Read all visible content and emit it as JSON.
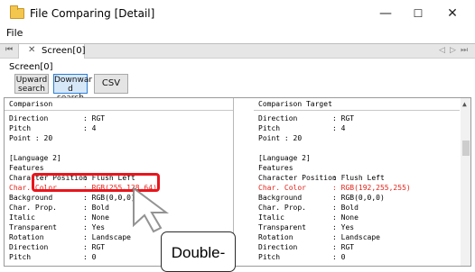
{
  "window": {
    "title": "File Comparing [Detail]",
    "controls": {
      "minimize": "—",
      "maximize": "☐",
      "close": "✕"
    }
  },
  "menu": {
    "file": "File"
  },
  "tabs": {
    "first_nav": "⏮",
    "items": [
      {
        "label": "Screen[0]",
        "close": "✕"
      }
    ],
    "nav_prev": "◁",
    "nav_next": "▷",
    "nav_last": "⏭"
  },
  "screen_label": "Screen[0]",
  "buttons": {
    "upward": [
      "Upward",
      "search"
    ],
    "downward": [
      "Downwar",
      "d search"
    ],
    "csv": "CSV"
  },
  "left_column": {
    "header": "Comparison",
    "rows": [
      {
        "k": "Direction",
        "v": ": RGT"
      },
      {
        "k": "Pitch",
        "v": ": 4"
      },
      {
        "k": "Point : 20",
        "v": ""
      },
      {
        "k": "",
        "v": ""
      },
      {
        "k": "[Language 2]",
        "v": ""
      },
      {
        "k": "Features",
        "v": ""
      },
      {
        "k": "Character Position",
        "v": ": Flush Left"
      },
      {
        "k": "Char. Color",
        "v": ": RGB(255,128,64)",
        "red": true
      },
      {
        "k": "Background",
        "v": ": RGB(0,0,0)"
      },
      {
        "k": "Char. Prop.",
        "v": ": Bold"
      },
      {
        "k": "Italic",
        "v": ": None"
      },
      {
        "k": "Transparent",
        "v": ": Yes"
      },
      {
        "k": "Rotation",
        "v": ": Landscape"
      },
      {
        "k": "Direction",
        "v": ": RGT"
      },
      {
        "k": "Pitch",
        "v": ": 0"
      }
    ]
  },
  "right_column": {
    "header": "Comparison Target",
    "rows": [
      {
        "k": "Direction",
        "v": ": RGT"
      },
      {
        "k": "Pitch",
        "v": ": 4"
      },
      {
        "k": "Point : 20",
        "v": ""
      },
      {
        "k": "",
        "v": ""
      },
      {
        "k": "[Language 2]",
        "v": ""
      },
      {
        "k": "Features",
        "v": ""
      },
      {
        "k": "Character Position",
        "v": ": Flush Left"
      },
      {
        "k": "Char. Color",
        "v": ": RGB(192,255,255)",
        "red": true
      },
      {
        "k": "Background",
        "v": ": RGB(0,0,0)"
      },
      {
        "k": "Char. Prop.",
        "v": ": Bold"
      },
      {
        "k": "Italic",
        "v": ": None"
      },
      {
        "k": "Transparent",
        "v": ": Yes"
      },
      {
        "k": "Rotation",
        "v": ": Landscape"
      },
      {
        "k": "Direction",
        "v": ": RGT"
      },
      {
        "k": "Pitch",
        "v": ": 0"
      }
    ]
  },
  "scroll": {
    "up": "▲"
  },
  "callout": {
    "text": "Double-"
  },
  "colors": {
    "accent_red": "#e8151c",
    "diff_red": "#e2231a",
    "button_blue": "#2d7fd5"
  }
}
